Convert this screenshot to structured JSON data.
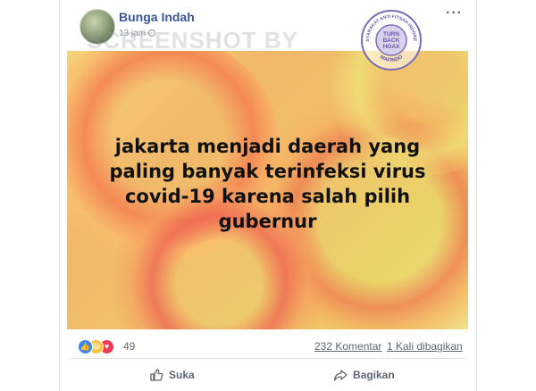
{
  "post": {
    "author": "Bunga Indah",
    "timestamp": "13 jam",
    "more_label": "···",
    "watermark": "SCREENSHOT BY",
    "seal": {
      "ring_text": "MASYARAKAT ANTI FITNAH INDONESIA",
      "center_text": [
        "TURN",
        "BACK",
        "HOAX"
      ],
      "bottom_text": "MAFINDO",
      "color": "#6a5aa8"
    },
    "image_text": "jakarta menjadi daerah yang paling banyak terinfeksi virus covid-19 karena salah pilih gubernur",
    "reactions": {
      "icons": [
        "like-icon",
        "haha-icon",
        "love-icon"
      ],
      "count": "49"
    },
    "comments": "232 Komentar",
    "shares": "1 Kali dibagikan"
  },
  "actions": {
    "like_label": "Suka",
    "share_label": "Bagikan"
  },
  "colors": {
    "author_link": "#385898",
    "meta_text": "#606770",
    "like_blue": "#3b84f5",
    "love_red": "#ef3b57",
    "haha_yellow": "#f7c43a"
  }
}
